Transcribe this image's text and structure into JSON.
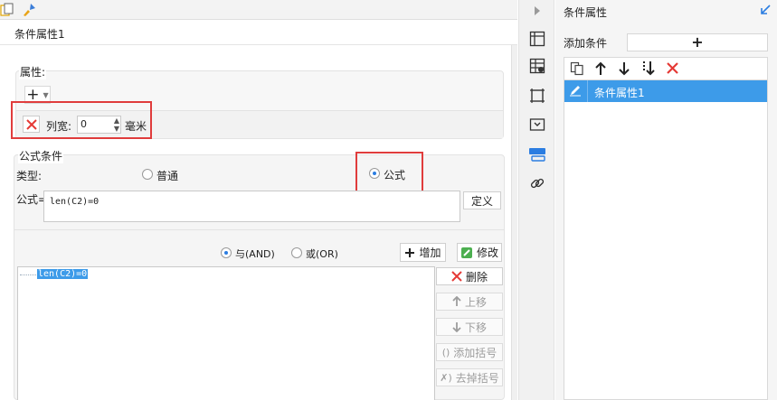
{
  "dialog": {
    "title": "条件属性1"
  },
  "attributes": {
    "label": "属性:",
    "add_symbol": "+",
    "column_width_label": "列宽:",
    "column_width_value": "0",
    "unit": "毫米"
  },
  "formula_condition": {
    "label": "公式条件",
    "type_label": "类型:",
    "type_options": [
      "普通",
      "公式"
    ],
    "selected_type": "公式",
    "formula_label": "公式=",
    "formula_value": "len(C2)=0",
    "define_button": "定义",
    "logic_options": [
      "与(AND)",
      "或(OR)"
    ],
    "selected_logic": "与(AND)",
    "add_button": "增加",
    "modify_button": "修改",
    "conditions": [
      "len(C2)=0"
    ],
    "side_buttons": {
      "delete": "删除",
      "move_up": "上移",
      "move_down": "下移",
      "add_bracket": "添加括号",
      "remove_bracket": "去掉括号"
    }
  },
  "right_panel": {
    "title": "条件属性",
    "add_condition_label": "添加条件",
    "add_symbol": "+",
    "items": [
      "条件属性1"
    ],
    "selected_item": "条件属性1"
  },
  "colors": {
    "accent_blue": "#3d9be9",
    "red_highlight": "#e03c3c",
    "delete_red": "#e53935"
  },
  "icons": {
    "toolbar": [
      "copy-icon",
      "arrow-up-icon",
      "arrow-down-icon",
      "move-to-bottom-icon",
      "delete-icon"
    ],
    "middle_bar": [
      "collapse-arrow-icon",
      "frozen-icon",
      "cell-attr-icon",
      "border-icon",
      "widget-icon",
      "condition-attr-icon",
      "hyperlink-icon"
    ]
  }
}
